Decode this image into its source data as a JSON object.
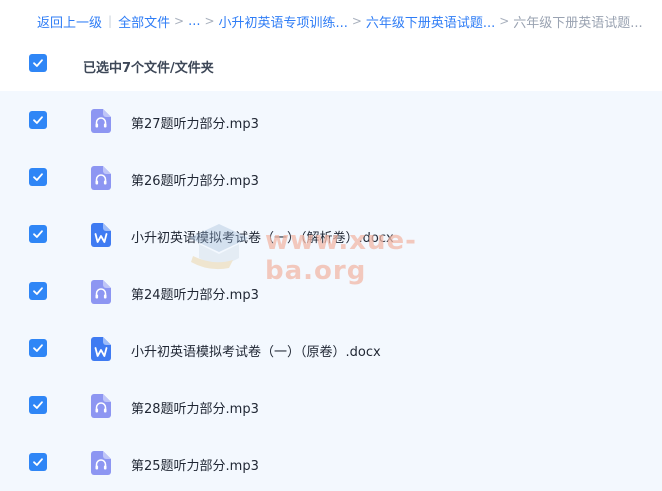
{
  "breadcrumb": {
    "back": "返回上一级",
    "all_files": "全部文件",
    "ellipsis": "...",
    "crumb1": "小升初英语专项训练...",
    "crumb2": "六年级下册英语试题...",
    "current": "六年级下册英语试题..."
  },
  "selection": {
    "summary": "已选中7个文件/文件夹",
    "all_checked": true
  },
  "files": [
    {
      "name": "第27题听力部分.mp3",
      "type": "audio",
      "checked": true
    },
    {
      "name": "第26题听力部分.mp3",
      "type": "audio",
      "checked": true
    },
    {
      "name": "小升初英语模拟考试卷（一）（解析卷）.docx",
      "type": "word",
      "checked": true
    },
    {
      "name": "第24题听力部分.mp3",
      "type": "audio",
      "checked": true
    },
    {
      "name": "小升初英语模拟考试卷（一）（原卷）.docx",
      "type": "word",
      "checked": true
    },
    {
      "name": "第28题听力部分.mp3",
      "type": "audio",
      "checked": true
    },
    {
      "name": "第25题听力部分.mp3",
      "type": "audio",
      "checked": true
    }
  ],
  "icons": {
    "audio": "headphones-file-icon",
    "word": "word-file-icon",
    "check": "checkmark-icon"
  },
  "watermark": {
    "text": "www.xue-ba.org"
  },
  "colors": {
    "accent": "#2f86f6",
    "link": "#2f7df6",
    "audio_icon": "#8d96f2",
    "word_icon": "#3f7bf2",
    "list_bg": "#f3f8fe"
  }
}
